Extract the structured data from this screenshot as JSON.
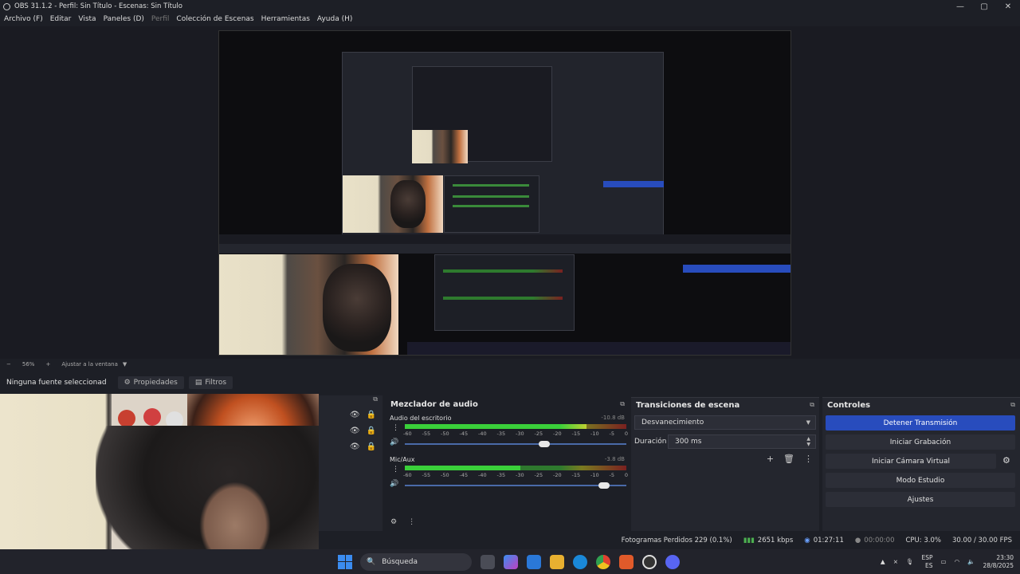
{
  "window": {
    "title": "OBS 31.1.2 - Perfil: Sin Título - Escenas: Sin Título",
    "controls": [
      "—",
      "▢",
      "✕"
    ]
  },
  "menu": [
    {
      "label": "Archivo (F)",
      "enabled": true
    },
    {
      "label": "Editar",
      "enabled": true
    },
    {
      "label": "Vista",
      "enabled": true
    },
    {
      "label": "Paneles (D)",
      "enabled": true
    },
    {
      "label": "Perfil",
      "enabled": false
    },
    {
      "label": "Colección de Escenas",
      "enabled": true
    },
    {
      "label": "Herramientas",
      "enabled": true
    },
    {
      "label": "Ayuda (H)",
      "enabled": true
    }
  ],
  "zoombar": {
    "zoom": "56%",
    "plus": "+",
    "fit": "Ajustar a la ventana",
    "arrow": "▼"
  },
  "sources": {
    "none_selected": "Ninguna fuente seleccionad",
    "properties": "Propiedades",
    "filters": "Filtros"
  },
  "mixer": {
    "title": "Mezclador de audio",
    "ticks": [
      "-60",
      "-55",
      "-50",
      "-45",
      "-40",
      "-35",
      "-30",
      "-25",
      "-20",
      "-15",
      "-10",
      "-5",
      "0"
    ],
    "channels": [
      {
        "name": "Audio del escritorio",
        "db": "-10.8 dB",
        "level": 0.82,
        "volume": 0.63
      },
      {
        "name": "Mic/Aux",
        "db": "-3.8 dB",
        "level": 0.52,
        "volume": 0.9
      }
    ]
  },
  "transitions": {
    "title": "Transiciones de escena",
    "selected": "Desvanecimiento",
    "duration_label": "Duración",
    "duration_value": "300 ms"
  },
  "controls": {
    "title": "Controles",
    "stop_stream": "Detener Transmisión",
    "start_recording": "Iniciar Grabación",
    "virtual_cam": "Iniciar Cámara Virtual",
    "studio_mode": "Modo Estudio",
    "settings": "Ajustes"
  },
  "status": {
    "dropped": "Fotogramas Perdidos 229 (0.1%)",
    "bitrate": "2651 kbps",
    "stream_time": "01:27:11",
    "rec_time": "00:00:00",
    "cpu": "CPU: 3.0%",
    "fps": "30.00 / 30.00 FPS"
  },
  "taskbar": {
    "search": "Búsqueda",
    "lang_top": "ESP",
    "lang_bottom": "ES",
    "time": "23:30",
    "date": "28/8/2025"
  },
  "colors": {
    "accent": "#284cbd",
    "panel": "#24262e",
    "bg": "#1d1f26"
  }
}
